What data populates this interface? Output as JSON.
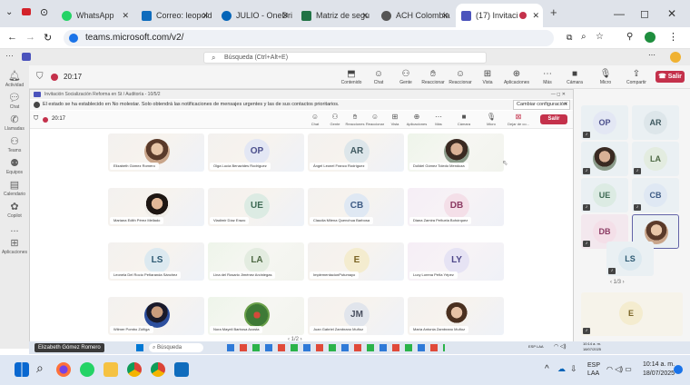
{
  "browser": {
    "tabs": [
      {
        "title": "WhatsApp",
        "color": "#25d366"
      },
      {
        "title": "Correo: leopold",
        "color": "#0f6cbd"
      },
      {
        "title": "JULIO - OneDri",
        "color": "#0364b8"
      },
      {
        "title": "Matriz de segu",
        "color": "#217346"
      },
      {
        "title": "ACH Colombia",
        "color": "#555555"
      },
      {
        "title": "(17) Invitaci",
        "color": "#4b53bc"
      }
    ],
    "url": "teams.microsoft.com/v2/",
    "window_controls": [
      "—",
      "◻",
      "✕"
    ]
  },
  "teams": {
    "search_placeholder": "Búsqueda (Ctrl+Alt+E)",
    "rail": [
      {
        "label": "Actividad",
        "icon": "bell-icon"
      },
      {
        "label": "Chat",
        "icon": "chat-icon"
      },
      {
        "label": "Llamadas",
        "icon": "phone-icon"
      },
      {
        "label": "Teams",
        "icon": "teams-icon"
      },
      {
        "label": "Equipos",
        "icon": "people-icon"
      },
      {
        "label": "Calendario",
        "icon": "calendar-icon"
      },
      {
        "label": "Copilot",
        "icon": "copilot-icon"
      },
      {
        "label": "...",
        "icon": "more-icon"
      },
      {
        "label": "Aplicaciones",
        "icon": "apps-icon"
      }
    ],
    "meeting": {
      "timer": "20:17",
      "toolbar": [
        "Contenido",
        "Chat",
        "Gente",
        "Reaccionar",
        "Reaccionar",
        "Vista",
        "Aplicaciones",
        "Más",
        "Cámara",
        "Micro",
        "Compartir"
      ],
      "leave_label": "Salir"
    },
    "inner": {
      "title": "Invitación Socialización Reforma en St / Auditoría - 10/5/2",
      "notice": "El estado se ha establecido en No molestar. Solo obtendrá las notificaciones de mensajes urgentes y las de sus contactos prioritarios.",
      "notice_action": "Cambiar configuración",
      "timer": "20:17",
      "toolbar": [
        "Chat",
        "Gente",
        "Reacciones",
        "Reaccionar",
        "Vista",
        "Aplicaciones",
        "Más",
        "Cámara",
        "Micro",
        "Dejar de co..."
      ],
      "leave_label": "Salir",
      "page": "1/2"
    },
    "participants": [
      {
        "name": "Elizabeth Gómez Romero",
        "initials": "",
        "photo": true
      },
      {
        "name": "Olga Lucía Benavides Rodríguez",
        "initials": "OP"
      },
      {
        "name": "Ángel Leonel Franco Rodríguez",
        "initials": "AR"
      },
      {
        "name": "Dolidel Gómez Toledo Mendoza",
        "initials": "",
        "photo": true
      },
      {
        "name": "Mariana Edith Pérez Mellado",
        "initials": "",
        "photo": true
      },
      {
        "name": "Vladimir Díaz Erazo",
        "initials": "UE"
      },
      {
        "name": "Claudia Milena Quenchua Barbosa",
        "initials": "CB"
      },
      {
        "name": "Diana Zamira Peñuela Bohórquez",
        "initials": "DB"
      },
      {
        "name": "Leonela Del Rocío Peñaranda Sánchez",
        "initials": "LS"
      },
      {
        "name": "Lina del Rosario Jiménez Arciniegas",
        "initials": "LA"
      },
      {
        "name": "ImplementacionPutumayo",
        "initials": "E"
      },
      {
        "name": "Lucy Lorena Peña Yépez",
        "initials": "LY"
      },
      {
        "name": "Wilmer Pombo Zúñiga",
        "initials": "",
        "photo": true
      },
      {
        "name": "Nora Mayeli Barbosa Acosta",
        "initials": "",
        "photo": true
      },
      {
        "name": "Juan Gabriel Zambrano Muñoz",
        "initials": "JM"
      },
      {
        "name": "María Antonia Zambrano Muñoz",
        "initials": "",
        "photo": true
      }
    ],
    "right_panel": {
      "tiles": [
        "OP",
        "AR",
        "",
        "LA",
        "UE",
        "CB",
        "DB",
        "",
        "LS",
        "E"
      ],
      "page": "1/3"
    },
    "inner_taskbar": {
      "active_name": "Elizabeth Gómez Romero",
      "search": "Búsqueda",
      "lang": "ESP LAA",
      "time": "10:14 a. m.",
      "date": "18/07/2025"
    }
  },
  "taskbar": {
    "lang": "ESP",
    "lang2": "LAA",
    "time": "10:14 a. m.",
    "date": "18/07/2025"
  }
}
